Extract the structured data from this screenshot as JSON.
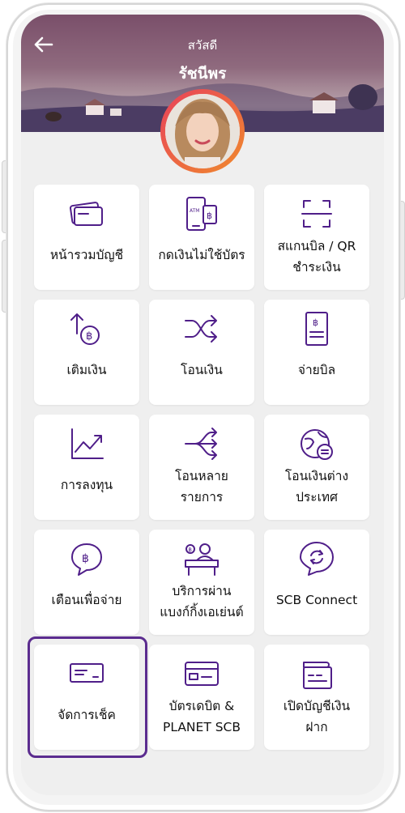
{
  "header": {
    "greeting": "สวัสดี",
    "user_name": "รัชนีพร",
    "back_icon": "back-arrow-icon"
  },
  "theme": {
    "accent": "#4f1e89",
    "selected_border": "#5b2c8f",
    "avatar_ring": "#e8415b"
  },
  "menu": [
    {
      "id": "accounts-summary",
      "icon": "card-icon",
      "lines": [
        "หน้ารวมบัญชี"
      ]
    },
    {
      "id": "cardless-withdraw",
      "icon": "atm-phone-icon",
      "lines": [
        "กดเงินไม่ใช้บัตร"
      ]
    },
    {
      "id": "scan-qr",
      "icon": "scan-icon",
      "lines": [
        "สแกนบิล / QR",
        "ชำระเงิน"
      ]
    },
    {
      "id": "top-up",
      "icon": "top-up-icon",
      "lines": [
        "เติมเงิน"
      ]
    },
    {
      "id": "transfer",
      "icon": "shuffle-icon",
      "lines": [
        "โอนเงิน"
      ]
    },
    {
      "id": "pay-bill",
      "icon": "bill-icon",
      "lines": [
        "จ่ายบิล"
      ]
    },
    {
      "id": "invest",
      "icon": "trend-chart-icon",
      "lines": [
        "การลงทุน"
      ]
    },
    {
      "id": "multi-transfer",
      "icon": "multi-transfer-icon",
      "lines": [
        "โอนหลาย",
        "รายการ"
      ]
    },
    {
      "id": "intl-transfer",
      "icon": "globe-transfer-icon",
      "lines": [
        "โอนเงินต่าง",
        "ประเทศ"
      ]
    },
    {
      "id": "payment-alert",
      "icon": "baht-bubble-icon",
      "lines": [
        "เตือนเพื่อจ่าย"
      ]
    },
    {
      "id": "agent-banking",
      "icon": "agent-counter-icon",
      "lines": [
        "บริการผ่าน",
        "แบงก์กิ้งเอเย่นต์"
      ]
    },
    {
      "id": "scb-connect",
      "icon": "scb-connect-icon",
      "lines": [
        "SCB Connect"
      ]
    },
    {
      "id": "manage-cheque",
      "icon": "cheque-icon",
      "lines": [
        "จัดการเช็ค"
      ],
      "selected": true
    },
    {
      "id": "debit-card",
      "icon": "debit-card-icon",
      "lines": [
        "บัตรเดบิต &",
        "PLANET SCB"
      ]
    },
    {
      "id": "open-deposit",
      "icon": "open-account-icon",
      "lines": [
        "เปิดบัญชีเงิน",
        "ฝาก"
      ]
    }
  ]
}
